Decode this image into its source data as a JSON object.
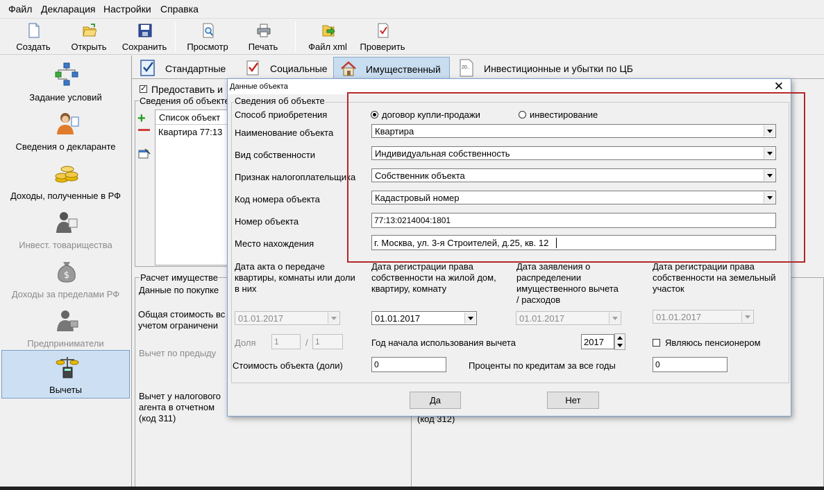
{
  "menu": [
    "Файл",
    "Декларация",
    "Настройки",
    "Справка"
  ],
  "toolbar": {
    "create": "Создать",
    "open": "Открыть",
    "save": "Сохранить",
    "preview": "Просмотр",
    "print": "Печать",
    "xml": "Файл xml",
    "check": "Проверить"
  },
  "sidebar": {
    "items": [
      {
        "label": "Задание условий"
      },
      {
        "label": "Сведения о декларанте"
      },
      {
        "label": "Доходы, полученные в РФ"
      },
      {
        "label": "Инвест. товарищества"
      },
      {
        "label": "Доходы за пределами РФ"
      },
      {
        "label": "Предприниматели"
      },
      {
        "label": "Вычеты"
      }
    ]
  },
  "tabs": {
    "standard": "Стандартные",
    "social": "Социальные",
    "property": "Имущественный",
    "invest": "Инвестиционные и убытки по ЦБ",
    "invest_icon_text": "20.."
  },
  "background": {
    "provide": "Предоставить и",
    "objects_section": "Сведения об объекте",
    "list_header": "Список объект",
    "list_row": "Квартира 77:13",
    "calc": "Расчет имуществе",
    "purchase": "Данные по покупке",
    "total_cost": "Общая стоимость вс",
    "total_cost2": "учетом ограничени",
    "prev_deduction": "Вычет по предыду",
    "agent_deduction": "Вычет у налогового",
    "agent_deduction2": "агента в отчетном",
    "code311": "(код 311)",
    "code312": "(код 312)"
  },
  "dialog": {
    "title": "Данные объекта",
    "close": "✕",
    "group_title": "Сведения об объекте",
    "acq_label": "Способ приобретения",
    "radio_sale": "договор купли-продажи",
    "radio_invest": "инвестирование",
    "name_label": "Наименование объекта",
    "name_value": "Квартира",
    "ownership_label": "Вид собственности",
    "ownership_value": "Индивидуальная собственность",
    "taxpayer_label": "Признак налогоплательщика",
    "taxpayer_value": "Собственник объекта",
    "code_label": "Код номера объекта",
    "code_value": "Кадастровый номер",
    "number_label": "Номер объекта",
    "number_value": "77:13:0214004:1801",
    "location_label": "Место нахождения",
    "location_value": "г. Москва, ул. 3-я Строителей, д.25, кв. 12",
    "date_act_label": "Дата акта о передаче квартиры, комнаты или доли в них",
    "date_act_value": "01.01.2017",
    "date_reg_label": "Дата регистрации права собственности на жилой дом, квартиру, комнату",
    "date_reg_value": "01.01.2017",
    "date_app_label": "Дата заявления о распределении имущественного вычета / расходов",
    "date_app_value": "01.01.2017",
    "date_land_label": "Дата регистрации права собственности на земельный участок",
    "date_land_value": "01.01.2017",
    "share_label": "Доля",
    "share_num": "1",
    "share_sep": "/",
    "share_den": "1",
    "year_label": "Год начала использования вычета",
    "year_value": "2017",
    "pensioner_label": "Являюсь пенсионером",
    "cost_label": "Стоимость объекта (доли)",
    "cost_value": "0",
    "interest_label": "Проценты по кредитам за все годы",
    "interest_value": "0",
    "yes": "Да",
    "no": "Нет"
  },
  "colors": {
    "highlight": "#b52626",
    "selected_bg": "#cde0f3",
    "dialog_border": "#7a9ed1"
  }
}
